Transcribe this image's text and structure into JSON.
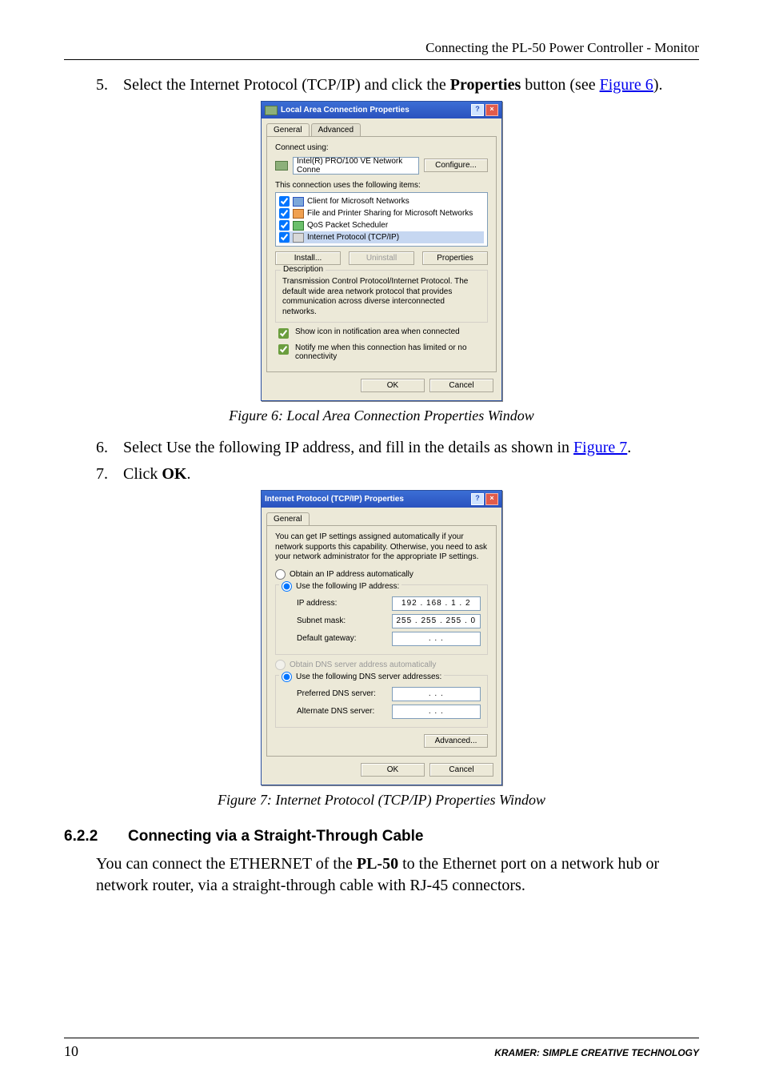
{
  "header": {
    "title": "Connecting the PL-50 Power Controller - Monitor"
  },
  "steps": {
    "s5": {
      "num": "5.",
      "pre": "Select the Internet Protocol (TCP/IP) and click the ",
      "bold": "Properties",
      "post": " button (see ",
      "link": "Figure 6",
      "after": ")."
    },
    "s6": {
      "num": "6.",
      "pre": "Select Use the following IP address, and fill in the details as shown in ",
      "link": "Figure 7",
      "after": "."
    },
    "s7": {
      "num": "7.",
      "pre": "Click ",
      "bold": "OK",
      "after": "."
    }
  },
  "dialog1": {
    "title": "Local Area Connection Properties",
    "tabs": {
      "general": "General",
      "advanced": "Advanced"
    },
    "connect_using": "Connect using:",
    "adapter": "Intel(R) PRO/100 VE Network Conne",
    "configure": "Configure...",
    "uses_items": "This connection uses the following items:",
    "items": {
      "client": "Client for Microsoft Networks",
      "fps": "File and Printer Sharing for Microsoft Networks",
      "qos": "QoS Packet Scheduler",
      "tcpip": "Internet Protocol (TCP/IP)"
    },
    "install": "Install...",
    "uninstall": "Uninstall",
    "properties": "Properties",
    "desc_legend": "Description",
    "desc_text": "Transmission Control Protocol/Internet Protocol. The default wide area network protocol that provides communication across diverse interconnected networks.",
    "show_icon": "Show icon in notification area when connected",
    "notify": "Notify me when this connection has limited or no connectivity",
    "ok": "OK",
    "cancel": "Cancel"
  },
  "fig6_caption": "Figure 6: Local Area Connection Properties Window",
  "dialog2": {
    "title": "Internet Protocol (TCP/IP) Properties",
    "tab_general": "General",
    "intro": "You can get IP settings assigned automatically if your network supports this capability. Otherwise, you need to ask your network administrator for the appropriate IP settings.",
    "r_auto_ip": "Obtain an IP address automatically",
    "r_use_ip": "Use the following IP address:",
    "ip_label": "IP address:",
    "ip_value": "192 . 168 .  1  .  2",
    "subnet_label": "Subnet mask:",
    "subnet_value": "255 . 255 . 255 .  0",
    "gateway_label": "Default gateway:",
    "gateway_value": ".       .       .",
    "r_auto_dns": "Obtain DNS server address automatically",
    "r_use_dns": "Use the following DNS server addresses:",
    "pref_dns": "Preferred DNS server:",
    "alt_dns": "Alternate DNS server:",
    "dns_blank": ".       .       .",
    "advanced": "Advanced...",
    "ok": "OK",
    "cancel": "Cancel"
  },
  "fig7_caption": "Figure 7: Internet Protocol (TCP/IP) Properties Window",
  "section": {
    "num": "6.2.2",
    "title": "Connecting via a Straight-Through Cable"
  },
  "para": {
    "p1a": "You can connect the ETHERNET of the ",
    "p1b": "PL-50",
    "p1c": " to the Ethernet port on a network hub or network router, via a straight-through cable with RJ-45 connectors."
  },
  "footer": {
    "page": "10",
    "brand": "KRAMER:  SIMPLE CREATIVE TECHNOLOGY"
  }
}
